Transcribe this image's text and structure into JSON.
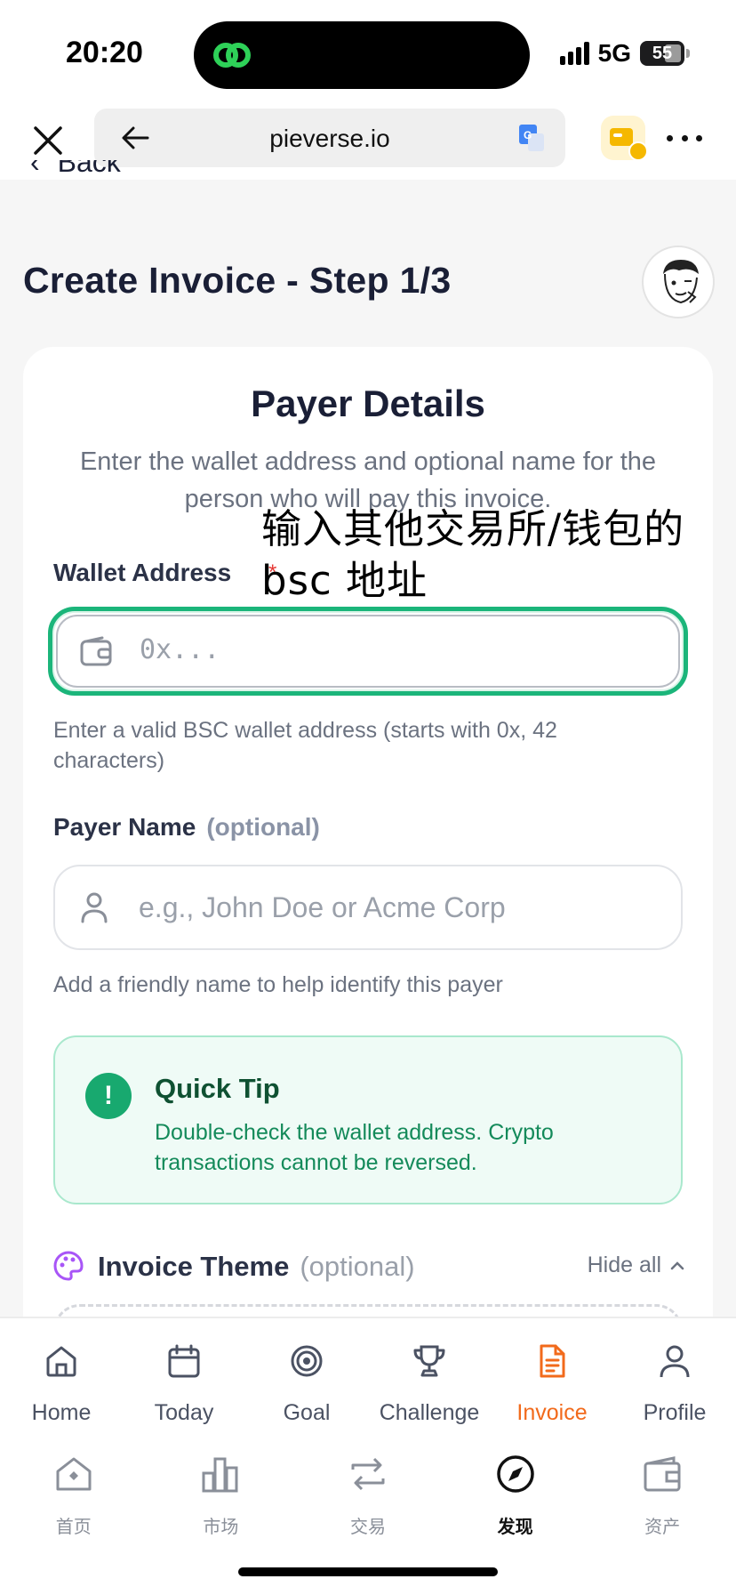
{
  "status": {
    "time": "20:20",
    "network": "5G",
    "battery": "55"
  },
  "browser": {
    "url": "pieverse.io"
  },
  "page": {
    "back_label": "Back",
    "title": "Create Invoice - Step 1/3"
  },
  "card": {
    "title": "Payer Details",
    "subtitle": "Enter the wallet address and optional name for the person who will pay this invoice.",
    "annotation_line1": "输入其他交易所/钱包的",
    "annotation_line2": "bsc 地址",
    "wallet": {
      "label": "Wallet Address",
      "required": "*",
      "placeholder": "0x...",
      "hint": "Enter a valid BSC wallet address (starts with 0x, 42 characters)"
    },
    "payer": {
      "label": "Payer Name",
      "optional": "(optional)",
      "placeholder": "e.g., John Doe or Acme Corp",
      "hint": "Add a friendly name to help identify this payer"
    },
    "tip": {
      "icon": "!",
      "title": "Quick Tip",
      "text": "Double-check the wallet address. Crypto transactions cannot be reversed."
    },
    "theme": {
      "label": "Invoice Theme",
      "optional": "(optional)",
      "toggle": "Hide all"
    }
  },
  "site_nav": [
    {
      "label": "Home",
      "icon": "home-icon"
    },
    {
      "label": "Today",
      "icon": "calendar-icon"
    },
    {
      "label": "Goal",
      "icon": "target-icon"
    },
    {
      "label": "Challenge",
      "icon": "trophy-icon"
    },
    {
      "label": "Invoice",
      "icon": "document-icon",
      "active": true
    },
    {
      "label": "Profile",
      "icon": "person-icon"
    }
  ],
  "app_nav": [
    {
      "label": "首页",
      "icon": "home-icon"
    },
    {
      "label": "市场",
      "icon": "bar-chart-icon"
    },
    {
      "label": "交易",
      "icon": "swap-icon"
    },
    {
      "label": "发现",
      "icon": "compass-icon",
      "active": true
    },
    {
      "label": "资产",
      "icon": "wallet-icon"
    }
  ],
  "colors": {
    "accent_green": "#1bb57a",
    "active_orange": "#f26a1b",
    "title_dark": "#1a1f36"
  }
}
